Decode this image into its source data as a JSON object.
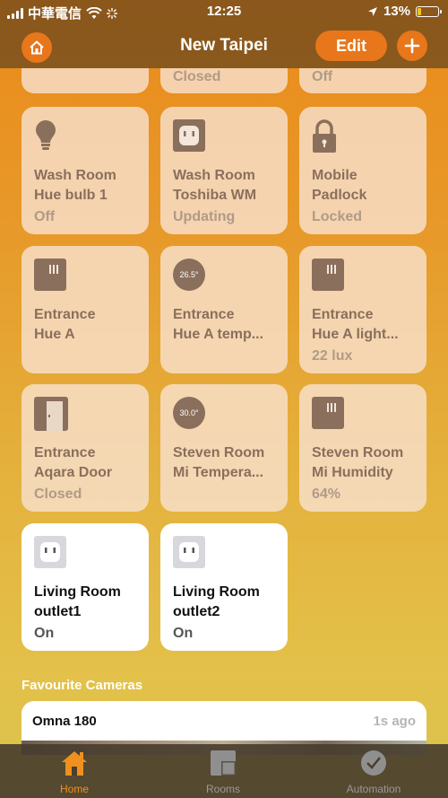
{
  "status_bar": {
    "carrier": "中華電信",
    "time": "12:25",
    "battery": "13%"
  },
  "header": {
    "title": "New Taipei",
    "edit_label": "Edit"
  },
  "partial_tiles": [
    {
      "status": ""
    },
    {
      "status": "Closed"
    },
    {
      "status": "Off"
    }
  ],
  "tiles": [
    {
      "name": "Wash Room\nHue bulb 1",
      "status": "Off",
      "icon": "lightbulb-icon",
      "on": false
    },
    {
      "name": "Wash Room\nToshiba WM",
      "status": "Updating",
      "icon": "outlet-icon",
      "on": false
    },
    {
      "name": "Mobile\nPadlock",
      "status": "Locked",
      "icon": "lock-icon",
      "on": false
    },
    {
      "name": "Entrance\nHue A",
      "status": "",
      "icon": "sensor-icon",
      "on": false
    },
    {
      "name": "Entrance\nHue A temp...",
      "status": "",
      "icon": "temperature-icon",
      "reading": "26.5°",
      "on": false
    },
    {
      "name": "Entrance\nHue A light...",
      "status": "22 lux",
      "icon": "sensor-icon",
      "on": false
    },
    {
      "name": "Entrance\nAqara Door",
      "status": "Closed",
      "icon": "door-icon",
      "on": false
    },
    {
      "name": "Steven Room\nMi Tempera...",
      "status": "",
      "icon": "temperature-icon",
      "reading": "30.0°",
      "on": false
    },
    {
      "name": "Steven Room\nMi Humidity",
      "status": "64%",
      "icon": "sensor-icon",
      "on": false
    },
    {
      "name": "Living Room\noutlet1",
      "status": "On",
      "icon": "outlet-icon",
      "on": true
    },
    {
      "name": "Living Room\noutlet2",
      "status": "On",
      "icon": "outlet-icon",
      "on": true
    }
  ],
  "cameras": {
    "section_title": "Favourite Cameras",
    "items": [
      {
        "name": "Omna 180",
        "time": "1s ago"
      }
    ]
  },
  "tabs": [
    {
      "label": "Home",
      "active": true
    },
    {
      "label": "Rooms",
      "active": false
    },
    {
      "label": "Automation",
      "active": false
    }
  ],
  "colors": {
    "accent": "#e8761a",
    "tile_inactive": "#f8e1cd",
    "tile_active": "#ffffff",
    "tab_active": "#f0901e"
  }
}
